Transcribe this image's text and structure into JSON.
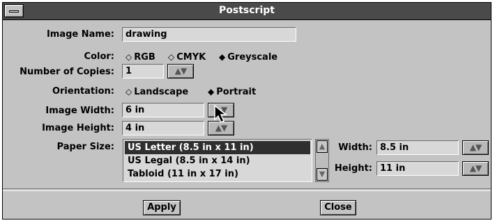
{
  "window": {
    "title": "Postscript"
  },
  "form": {
    "image_name": {
      "label": "Image Name:",
      "value": "drawing"
    },
    "color": {
      "label": "Color:",
      "options": [
        "RGB",
        "CMYK",
        "Greyscale"
      ],
      "selected": "Greyscale"
    },
    "copies": {
      "label": "Number of Copies:",
      "value": "1"
    },
    "orientation": {
      "label": "Orientation:",
      "options": [
        "Landscape",
        "Portrait"
      ],
      "selected": "Portrait"
    },
    "image_width": {
      "label": "Image Width:",
      "value": "6 in"
    },
    "image_height": {
      "label": "Image Height:",
      "value": "4 in"
    },
    "paper_size": {
      "label": "Paper Size:",
      "items": [
        "US Letter (8.5 in x 11 in)",
        "US Legal (8.5 in x 14 in)",
        "Tabloid (11 in x 17 in)"
      ],
      "selected_index": 0
    },
    "width": {
      "label": "Width:",
      "value": "8.5 in"
    },
    "height": {
      "label": "Height:",
      "value": "11 in"
    }
  },
  "buttons": {
    "apply": "Apply",
    "close": "Close"
  },
  "icons": {
    "spin": "up-down-arrows-icon",
    "radio_on": "filled-diamond-icon",
    "radio_off": "hollow-diamond-icon",
    "cursor": "mouse-pointer-icon"
  }
}
